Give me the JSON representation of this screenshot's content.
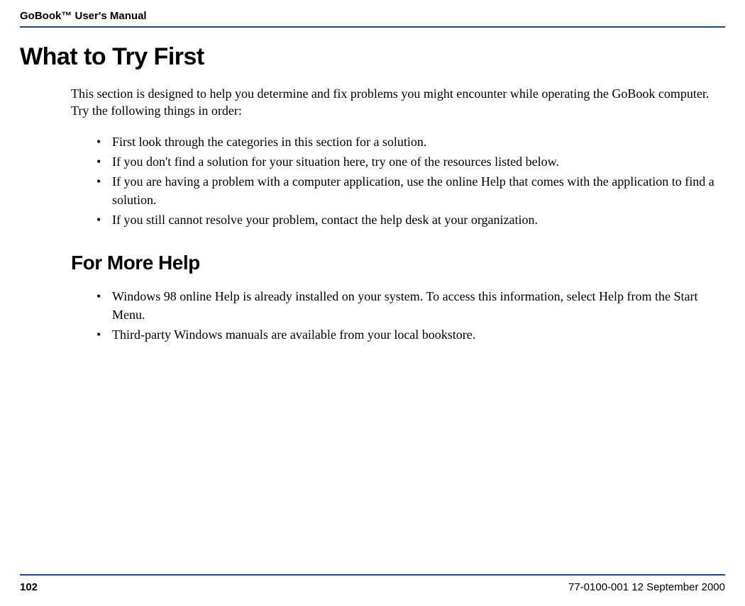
{
  "header": {
    "title": "GoBook™ User's Manual"
  },
  "main": {
    "title": "What to Try First",
    "intro": "This section is designed to help you determine and fix problems you might encounter while operating the GoBook computer. Try the following things in order:",
    "bullets1": [
      "First look through the categories in this section for a solution.",
      "If you don't find a solution for your situation here, try one of the resources listed below.",
      "If you are having a problem with a computer application, use the online Help that comes with the application to find a solution.",
      "If you still cannot resolve your problem, contact the help desk at your organization."
    ],
    "subheading": "For More Help",
    "bullets2": [
      "Windows 98 online Help is already installed on your system. To access this information, select Help from the Start Menu.",
      "Third-party Windows manuals are available from your local bookstore."
    ]
  },
  "footer": {
    "page_number": "102",
    "doc_meta": "77-0100-001   12 September 2000"
  }
}
